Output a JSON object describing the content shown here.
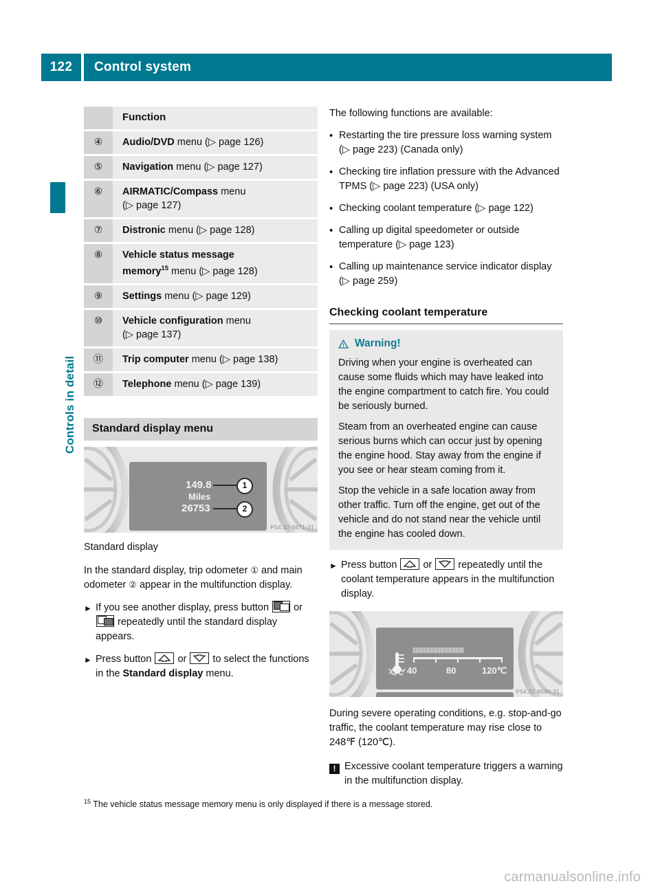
{
  "header": {
    "page_number": "122",
    "title": "Control system",
    "side_tab_label": "Controls in detail"
  },
  "colors": {
    "teal": "#00788f",
    "table_num_bg": "#d4d4d4",
    "table_txt_bg": "#ebebeb",
    "warn_bg": "#e9e9e9"
  },
  "function_table": {
    "header_label": "Function",
    "rows": [
      {
        "num": "④",
        "bold": "Audio/DVD",
        "rest": " menu (▷ page 126)"
      },
      {
        "num": "⑤",
        "bold": "Navigation",
        "rest": " menu (▷ page 127)"
      },
      {
        "num": "⑥",
        "bold": "AIRMATIC/Compass",
        "rest": " menu",
        "line2": "(▷ page 127)"
      },
      {
        "num": "⑦",
        "bold": "Distronic",
        "rest": " menu (▷ page 128)"
      },
      {
        "num": "⑧",
        "bold": "Vehicle status message",
        "rest": "",
        "line2bold": "memory",
        "footnote": "15",
        "line2rest": " menu (▷ page 128)"
      },
      {
        "num": "⑨",
        "bold": "Settings",
        "rest": " menu (▷ page 129)"
      },
      {
        "num": "⑩",
        "bold": "Vehicle configuration",
        "rest": " menu",
        "line2": "(▷ page 137)"
      },
      {
        "num": "⑪",
        "bold": "Trip computer",
        "rest": " menu (▷ page 138)"
      },
      {
        "num": "⑫",
        "bold": "Telephone",
        "rest": " menu (▷ page 139)"
      }
    ]
  },
  "standard_display": {
    "section_title": "Standard display menu",
    "figure": {
      "trip_odometer_value": "149.8",
      "units_label": "Miles",
      "main_odometer_value": "26753",
      "callout_1": "1",
      "callout_2": "2",
      "image_code": "P54.32-6671-31"
    },
    "caption": "Standard display",
    "intro_part1": "In the standard display, trip odometer ",
    "intro_callout1": "①",
    "intro_part2": " and main odometer ",
    "intro_callout2": "②",
    "intro_part3": " appear in the multifunction display.",
    "step1_part1": "If you see another display, press button ",
    "step1_part2": " or ",
    "step1_part3": " repeatedly until the standard display appears.",
    "step2_part1": "Press button ",
    "step2_part2": " or ",
    "step2_part3": " to select the functions in the ",
    "step2_bold": "Standard display",
    "step2_part4": " menu."
  },
  "right_column": {
    "intro": "The following functions are available:",
    "bullets": [
      "Restarting the tire pressure loss warning system (▷ page 223) (Canada only)",
      "Checking tire inflation pressure with the Advanced TPMS (▷ page 223) (USA only)",
      "Checking coolant temperature (▷ page 122)",
      "Calling up digital speedometer or outside temperature (▷ page 123)",
      "Calling up maintenance service indicator display (▷ page 259)"
    ],
    "heading": "Checking coolant temperature",
    "warning": {
      "title": "Warning!",
      "paragraphs": [
        "Driving when your engine is overheated can cause some fluids which may have leaked into the engine compartment to catch fire. You could be seriously burned.",
        "Steam from an overheated engine can cause serious burns which can occur just by opening the engine hood. Stay away from the engine if you see or hear steam coming from it.",
        "Stop the vehicle in a safe location away from other traffic. Turn off the engine, get out of the vehicle and do not stand near the vehicle until the engine has cooled down."
      ]
    },
    "step_part1": "Press button ",
    "step_part2": " or ",
    "step_part3": " repeatedly until the coolant temperature appears in the multifunction display.",
    "coolant_figure": {
      "tick_40": "40",
      "tick_80": "80",
      "tick_120": "120℃",
      "image_code": "P54.32-6590-31"
    },
    "closing_para": "During severe operating conditions, e.g. stop-and-go traffic, the coolant temperature may rise close to 248℉ (120℃).",
    "note_text": "Excessive coolant temperature triggers a warning in the multifunction display.",
    "note_icon_char": "!"
  },
  "footnote": {
    "marker": "15",
    "text": " The vehicle status message memory menu is only displayed if there is a message stored."
  },
  "watermark": "carmanualsonline.info"
}
